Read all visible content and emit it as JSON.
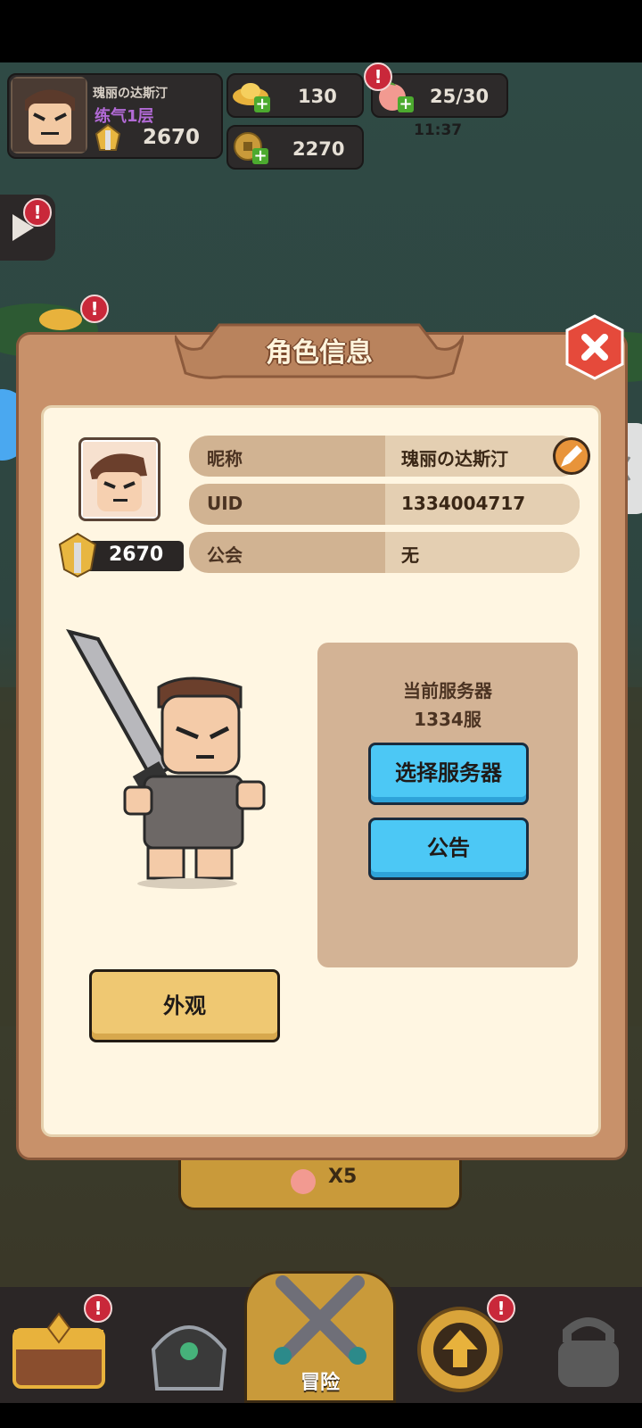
{
  "player": {
    "name": "瑰丽の达斯汀",
    "realm": "练气1层",
    "power": "2670"
  },
  "resources": {
    "gold_ingot": "130",
    "coin": "2270",
    "stamina": "25/30",
    "stamina_timer": "11:37"
  },
  "dialog": {
    "title": "角色信息",
    "rows": [
      {
        "label": "昵称",
        "value": "瑰丽の达斯汀"
      },
      {
        "label": "UID",
        "value": "1334004717"
      },
      {
        "label": "公会",
        "value": "无"
      }
    ],
    "power": "2670",
    "server_label": "当前服务器",
    "server_value": "1334服",
    "select_server_button": "选择服务器",
    "notice_button": "公告",
    "appearance_button": "外观"
  },
  "background": {
    "peach_reward": "X5"
  },
  "notifications": {
    "badge": "!"
  },
  "bottom_nav": {
    "adventure_label": "冒险"
  },
  "colors": {
    "dialog_frame": "#c8916a",
    "dialog_inner": "#fff6e2",
    "blue_button": "#4cc8f5",
    "yellow_button": "#efc872",
    "badge_red": "#c9283a"
  }
}
